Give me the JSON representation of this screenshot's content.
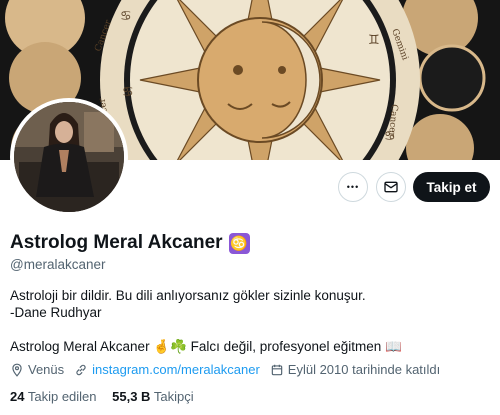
{
  "banner": {
    "description_icon": "sun-moon-zodiac-banner",
    "signs": [
      "Cancer",
      "Gemini",
      "Cancer",
      "Gemini"
    ]
  },
  "profile": {
    "display_name": "Astrolog Meral Akcaner",
    "badge_glyph": "♋",
    "handle": "@meralakcaner",
    "bio_line1": "Astroloji bir dildir. Bu dili anlıyorsanız gökler sizinle konuşur.",
    "bio_line2": "-Dane Rudhyar",
    "bio_line3": "Astrolog Meral Akcaner 🤞☘️ Falcı değil, profesyonel eğitmen 📖"
  },
  "actions": {
    "more_glyph": "•••",
    "follow_label": "Takip et"
  },
  "meta": {
    "location": "Venüs",
    "link": "instagram.com/meralakcaner",
    "joined": "Eylül 2010 tarihinde katıldı"
  },
  "stats": {
    "following_count": "24",
    "following_label": "Takip edilen",
    "followers_count": "55,3 B",
    "followers_label": "Takipçi"
  },
  "colors": {
    "accent": "#1d9bf0",
    "primary_button": "#0f1419",
    "badge": "#8a57d6"
  }
}
